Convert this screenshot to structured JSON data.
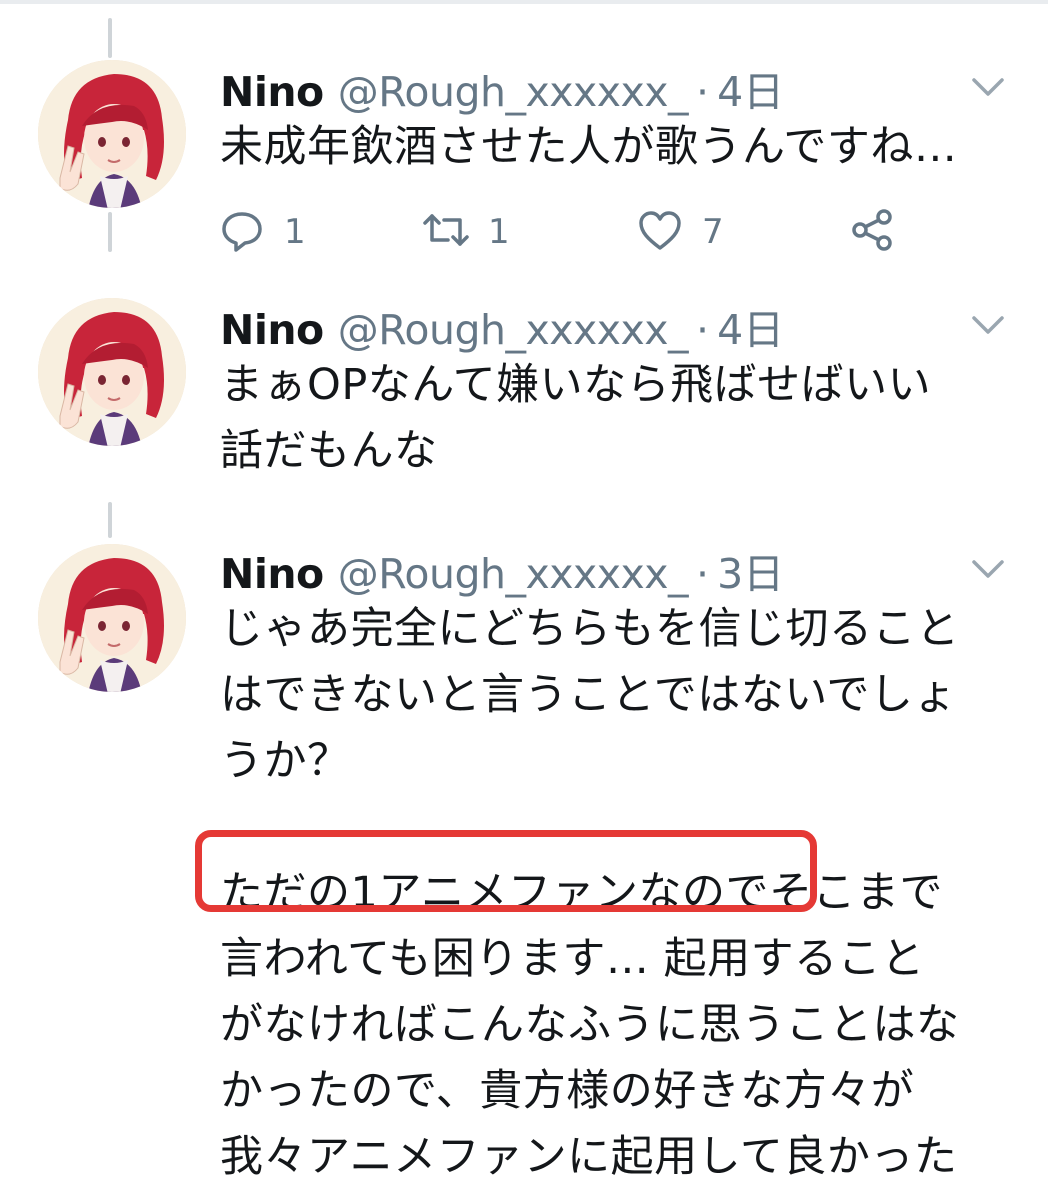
{
  "tweets": [
    {
      "name": "Nino",
      "handle": "@Rough_xxxxxx_",
      "separator": "·",
      "time": "4日",
      "text": "未成年飲酒させた人が歌うんですね…",
      "actions": {
        "reply_count": "1",
        "retweet_count": "1",
        "like_count": "7"
      }
    },
    {
      "name": "Nino",
      "handle": "@Rough_xxxxxx_",
      "separator": "·",
      "time": "4日",
      "text": "まぁOPなんて嫌いなら飛ばせばいい\n話だもんな"
    },
    {
      "name": "Nino",
      "handle": "@Rough_xxxxxx_",
      "separator": "·",
      "time": "3日",
      "text": "じゃあ完全にどちらもを信じ切ること\nはできないと言うことではないでしょ\nうか？\n\nただの1アニメファンなのでそこまで\n言われても困ります… 起用すること\nがなければこんなふうに思うことはな\nかったので、貴方様の好きな方々が\n我々アニメファンに起用して良かった"
    }
  ],
  "colors": {
    "text": "#14171a",
    "secondary": "#657786",
    "icon": "#657786",
    "highlight": "#e53935",
    "thread_line": "#cfd4d8"
  },
  "icons": [
    "reply-icon",
    "retweet-icon",
    "like-icon",
    "share-icon",
    "chevron-down-icon"
  ]
}
